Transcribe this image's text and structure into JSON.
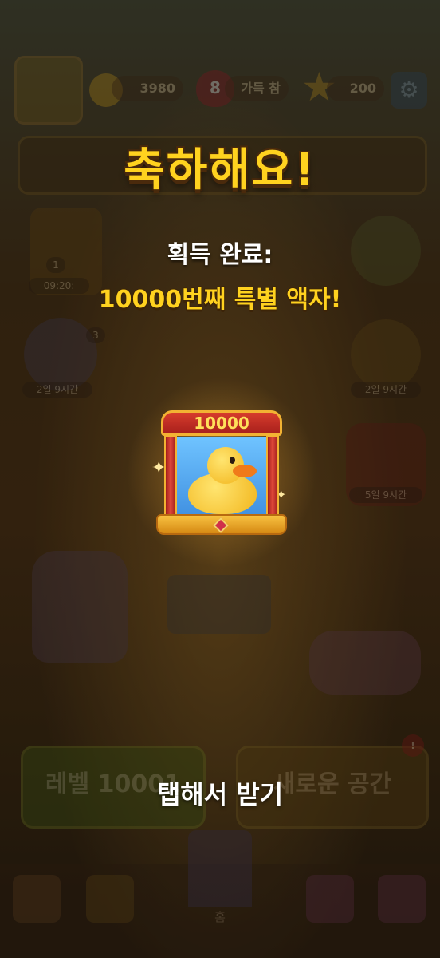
{
  "hud": {
    "coins": "3980",
    "lives": "8",
    "lives_label": "가득 참",
    "stars": "200"
  },
  "reward": {
    "title": "축하해요!",
    "subtitle": "획득 완료:",
    "item_name": "10000번째 특별 액자!",
    "frame_number": "10000"
  },
  "background_labels": {
    "trophy_timer": "09:20:",
    "trophy_rank": "1",
    "balls_timer": "2일 9시간",
    "balls_count": "3",
    "wheel_timer": "2일 9시간",
    "crown_timer": "5일 9시간",
    "level_button": "레벨 10001",
    "new_space_button": "새로운 공간",
    "alert_badge": "!",
    "home_label": "홈"
  },
  "tap_prompt": "탭해서 받기"
}
